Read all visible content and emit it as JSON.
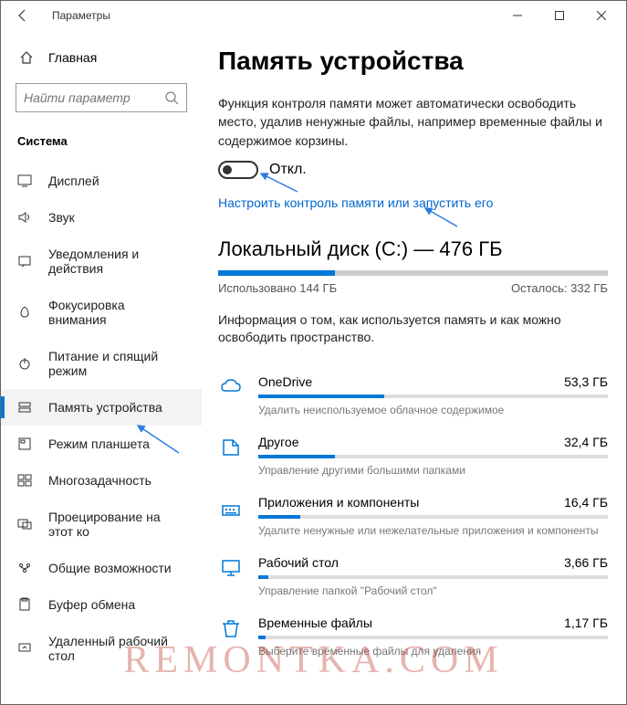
{
  "window": {
    "title": "Параметры"
  },
  "sidebar": {
    "home": "Главная",
    "search_placeholder": "Найти параметр",
    "section": "Система",
    "items": [
      {
        "label": "Дисплей"
      },
      {
        "label": "Звук"
      },
      {
        "label": "Уведомления и действия"
      },
      {
        "label": "Фокусировка внимания"
      },
      {
        "label": "Питание и спящий режим"
      },
      {
        "label": "Память устройства"
      },
      {
        "label": "Режим планшета"
      },
      {
        "label": "Многозадачность"
      },
      {
        "label": "Проецирование на этот ко"
      },
      {
        "label": "Общие возможности"
      },
      {
        "label": "Буфер обмена"
      },
      {
        "label": "Удаленный рабочий стол"
      }
    ]
  },
  "main": {
    "heading": "Память устройства",
    "description": "Функция контроля памяти может автоматически освободить место, удалив ненужные файлы, например временные файлы и содержимое корзины.",
    "toggle_label": "Откл.",
    "config_link": "Настроить контроль памяти или запустить его",
    "disk_title": "Локальный диск (C:) — 476 ГБ",
    "used": "Использовано 144 ГБ",
    "free": "Осталось: 332 ГБ",
    "info": "Информация о том, как используется память и как можно освободить пространство.",
    "categories": [
      {
        "name": "OneDrive",
        "size": "53,3 ГБ",
        "desc": "Удалить неиспользуемое облачное содержимое",
        "pct": 36
      },
      {
        "name": "Другое",
        "size": "32,4 ГБ",
        "desc": "Управление другими большими папками",
        "pct": 22
      },
      {
        "name": "Приложения и компоненты",
        "size": "16,4 ГБ",
        "desc": "Удалите ненужные или нежелательные приложения и компоненты",
        "pct": 12
      },
      {
        "name": "Рабочий стол",
        "size": "3,66 ГБ",
        "desc": "Управление папкой \"Рабочий стол\"",
        "pct": 3
      },
      {
        "name": "Временные файлы",
        "size": "1,17 ГБ",
        "desc": "Выберите временные файлы для удаления",
        "pct": 2
      }
    ]
  },
  "watermark": "REMONTKA.COM"
}
